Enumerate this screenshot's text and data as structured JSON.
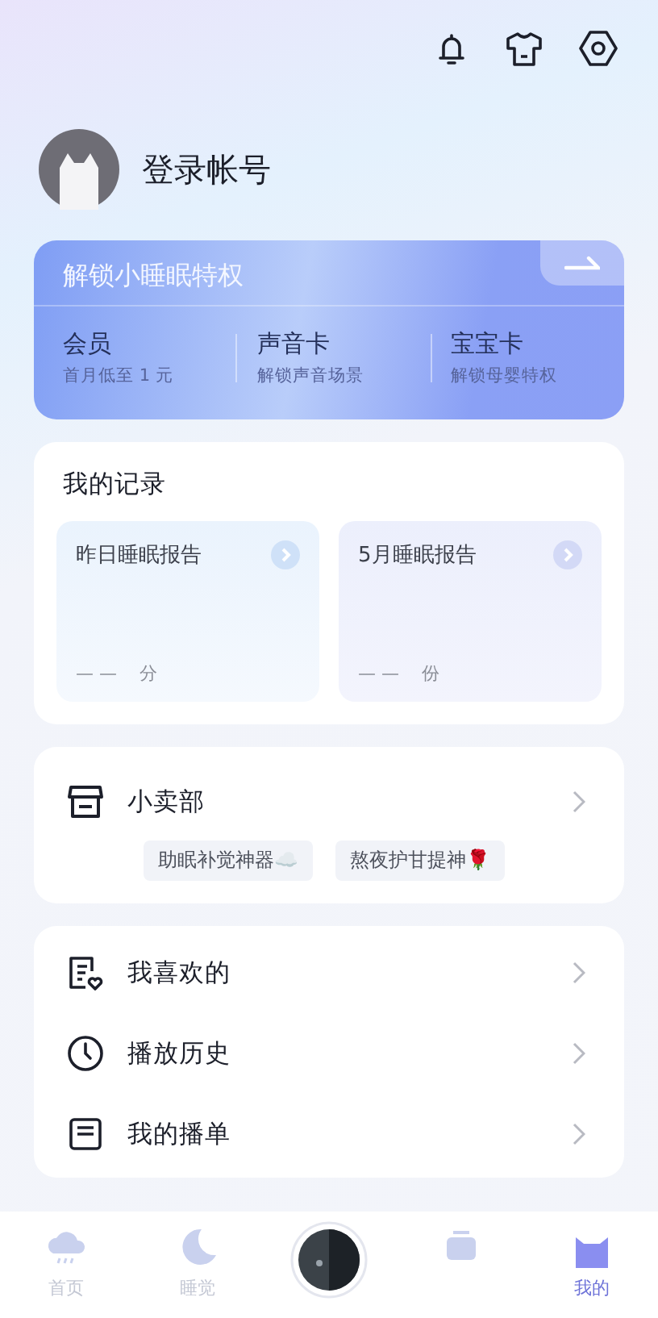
{
  "header": {
    "login_label": "登录帐号"
  },
  "vip": {
    "title": "解锁小睡眠特权",
    "items": [
      {
        "title": "会员",
        "subtitle": "首月低至 1 元"
      },
      {
        "title": "声音卡",
        "subtitle": "解锁声音场景"
      },
      {
        "title": "宝宝卡",
        "subtitle": "解锁母婴特权"
      }
    ]
  },
  "records": {
    "title": "我的记录",
    "cards": [
      {
        "title": "昨日睡眠报告",
        "placeholder": "— —",
        "unit": "分"
      },
      {
        "title": "5月睡眠报告",
        "placeholder": "— —",
        "unit": "份"
      }
    ]
  },
  "shop": {
    "title": "小卖部",
    "tags": [
      "助眠补觉神器☁️",
      "熬夜护甘提神🌹"
    ]
  },
  "menu": [
    {
      "kind": "favorites",
      "label": "我喜欢的"
    },
    {
      "kind": "history",
      "label": "播放历史"
    },
    {
      "kind": "playlist",
      "label": "我的播单"
    }
  ],
  "tab_bar": [
    {
      "kind": "home",
      "label": "首页",
      "selected": false
    },
    {
      "kind": "sleep",
      "label": "睡觉",
      "selected": false
    },
    {
      "kind": "player"
    },
    {
      "kind": "community"
    },
    {
      "kind": "mine",
      "label": "我的",
      "selected": true
    }
  ]
}
